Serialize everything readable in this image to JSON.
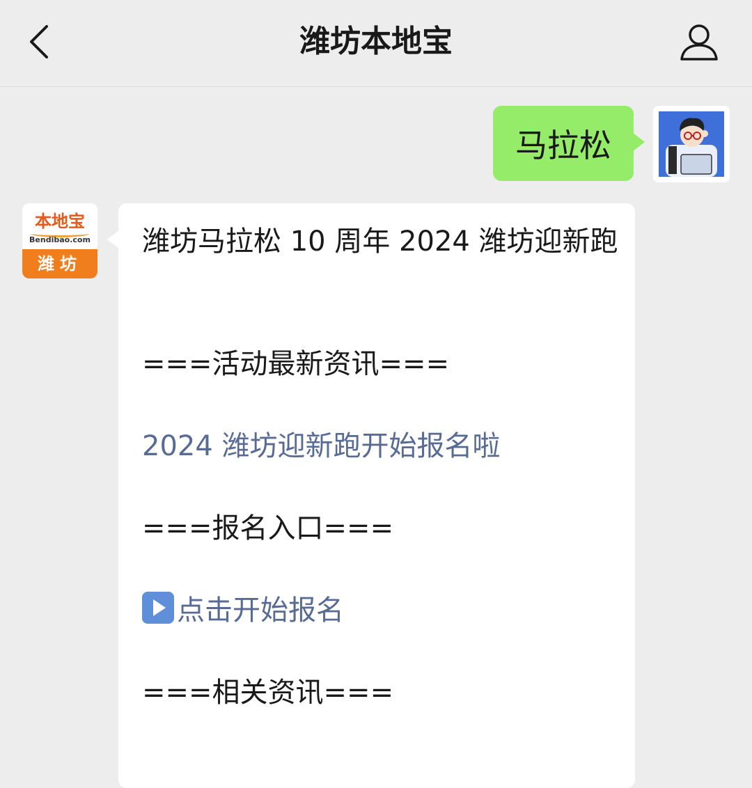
{
  "header": {
    "title": "潍坊本地宝",
    "back_icon": "chevron-left-icon",
    "profile_icon": "user-icon"
  },
  "messages": {
    "outgoing": {
      "text": "马拉松"
    },
    "incoming": {
      "avatar": {
        "logo_cn": "本地宝",
        "logo_en": "Bendibao.com",
        "city": "潍坊"
      },
      "line1": "潍坊马拉松 10 周年 2024 潍坊迎新跑",
      "section1": "===活动最新资讯===",
      "link1": "2024 潍坊迎新跑开始报名啦",
      "section2": "===报名入口===",
      "link2": "点击开始报名",
      "section3": "===相关资讯==="
    }
  },
  "colors": {
    "background": "#ededed",
    "outgoing_bubble": "#95ec69",
    "incoming_bubble": "#ffffff",
    "link": "#576b95",
    "brand_orange": "#f07e1c"
  }
}
